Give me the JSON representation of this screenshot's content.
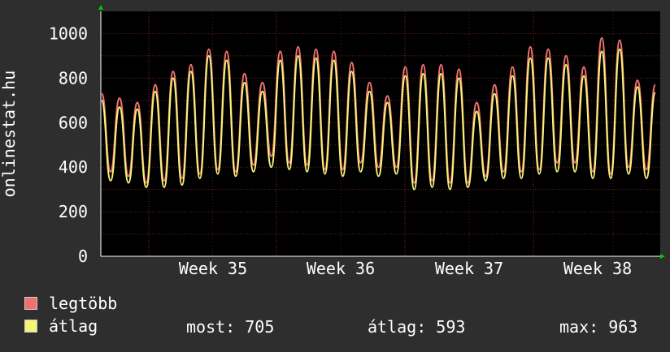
{
  "chart_data": {
    "type": "line",
    "ylabel": "onlinestat.hu",
    "ylim": [
      0,
      1100
    ],
    "yticks": [
      0,
      200,
      400,
      600,
      800,
      1000
    ],
    "x_tick_labels": [
      "Week 35",
      "Week 36",
      "Week 37",
      "Week 38"
    ],
    "grid": true,
    "legend_placement": "bottom-left",
    "series": [
      {
        "name": "legtöbb",
        "color": "#f07070",
        "values": [
          730,
          380,
          710,
          360,
          690,
          330,
          770,
          340,
          830,
          350,
          860,
          370,
          930,
          390,
          920,
          380,
          820,
          410,
          780,
          450,
          920,
          420,
          940,
          410,
          930,
          390,
          920,
          390,
          870,
          420,
          780,
          400,
          720,
          400,
          850,
          330,
          860,
          340,
          860,
          330,
          840,
          330,
          690,
          360,
          770,
          380,
          850,
          380,
          940,
          390,
          930,
          420,
          900,
          420,
          850,
          380,
          980,
          370,
          970,
          400,
          790,
          390,
          770
        ]
      },
      {
        "name": "átlag",
        "color": "#f4f47a",
        "values": [
          700,
          340,
          670,
          330,
          660,
          310,
          740,
          310,
          800,
          320,
          830,
          350,
          900,
          370,
          880,
          360,
          780,
          380,
          740,
          400,
          880,
          390,
          900,
          380,
          890,
          370,
          880,
          360,
          830,
          380,
          740,
          360,
          690,
          370,
          810,
          300,
          820,
          310,
          820,
          300,
          800,
          310,
          650,
          340,
          730,
          350,
          810,
          350,
          890,
          370,
          890,
          380,
          860,
          380,
          810,
          350,
          920,
          350,
          930,
          370,
          760,
          350,
          735
        ]
      }
    ],
    "stats": {
      "most": {
        "label": "most:",
        "value": "705"
      },
      "atlag": {
        "label": "átlag:",
        "value": "593"
      },
      "max": {
        "label": "max:",
        "value": "963"
      }
    }
  }
}
